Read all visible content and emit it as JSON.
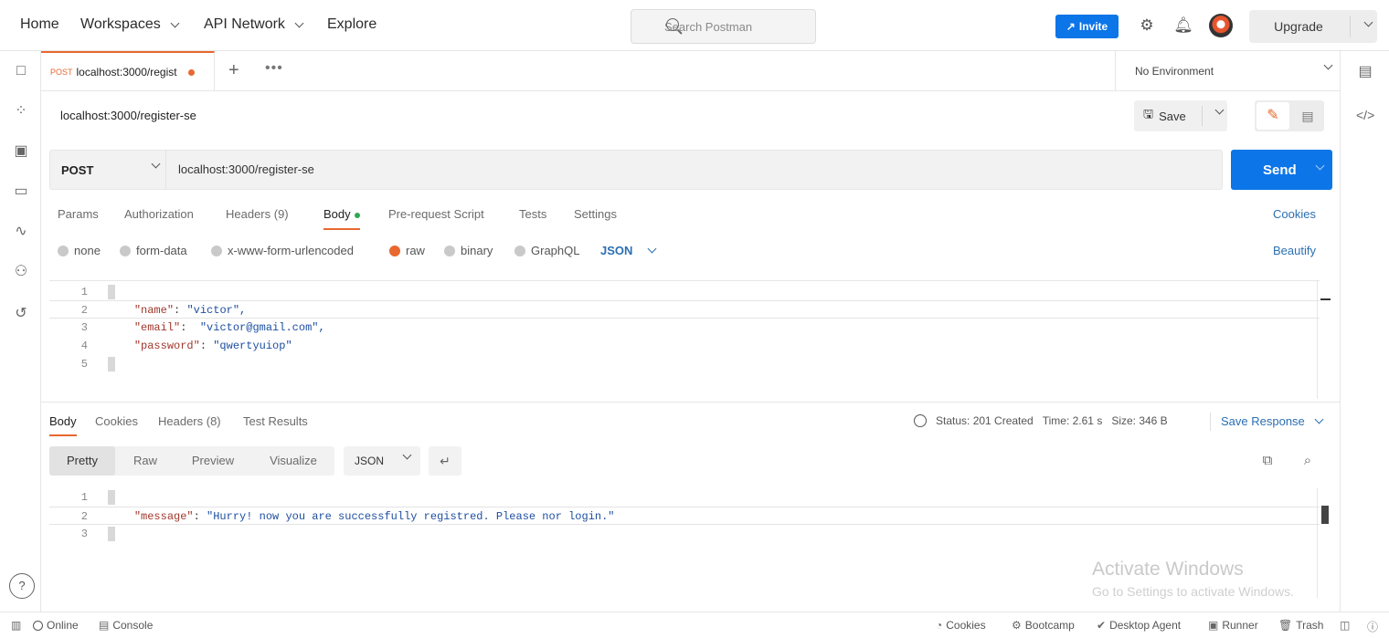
{
  "nav": {
    "home": "Home",
    "workspaces": "Workspaces",
    "api_network": "API Network",
    "explore": "Explore",
    "search_placeholder": "Search Postman",
    "invite": "Invite",
    "upgrade": "Upgrade"
  },
  "tabs": {
    "active_method": "POST",
    "active_label": "localhost:3000/regist",
    "environment": "No Environment"
  },
  "request": {
    "title": "localhost:3000/register-se",
    "save_label": "Save",
    "method": "POST",
    "url": "localhost:3000/register-se",
    "send_label": "Send",
    "tabs": [
      "Params",
      "Authorization",
      "Headers (9)",
      "Body",
      "Pre-request Script",
      "Tests",
      "Settings"
    ],
    "active_tab": "Body",
    "cookies_link": "Cookies",
    "body_types": [
      "none",
      "form-data",
      "x-www-form-urlencoded",
      "raw",
      "binary",
      "GraphQL"
    ],
    "selected_body_type": "raw",
    "format": "JSON",
    "beautify": "Beautify",
    "body_lines": [
      {
        "num": "1",
        "text": "{"
      },
      {
        "num": "2",
        "key": "\"name\"",
        "value": "\"victor\","
      },
      {
        "num": "3",
        "key": "\"email\"",
        "value": "\"victor@gmail.com\","
      },
      {
        "num": "4",
        "key": "\"password\"",
        "value": "\"qwertyuiop\""
      },
      {
        "num": "5",
        "text": "}"
      }
    ]
  },
  "response": {
    "tabs": [
      "Body",
      "Cookies",
      "Headers (8)",
      "Test Results"
    ],
    "active_tab": "Body",
    "status": "Status: 201 Created",
    "time": "Time: 2.61 s",
    "size": "Size: 346 B",
    "save_response": "Save Response",
    "views": [
      "Pretty",
      "Raw",
      "Preview",
      "Visualize"
    ],
    "active_view": "Pretty",
    "format": "JSON",
    "body_lines": [
      {
        "num": "1",
        "text": "{"
      },
      {
        "num": "2",
        "key": "\"message\"",
        "value": "\"Hurry! now you are successfully registred. Please nor login.\""
      },
      {
        "num": "3",
        "text": "}"
      }
    ]
  },
  "watermark": {
    "line1": "Activate Windows",
    "line2": "Go to Settings to activate Windows."
  },
  "footer": {
    "online": "Online",
    "console": "Console",
    "cookies": "Cookies",
    "bootcamp": "Bootcamp",
    "desktop_agent": "Desktop Agent",
    "runner": "Runner",
    "trash": "Trash"
  },
  "colors": {
    "accent": "#e8682f",
    "primary_blue": "#0c75e8",
    "link_blue": "#2b6fb3"
  }
}
